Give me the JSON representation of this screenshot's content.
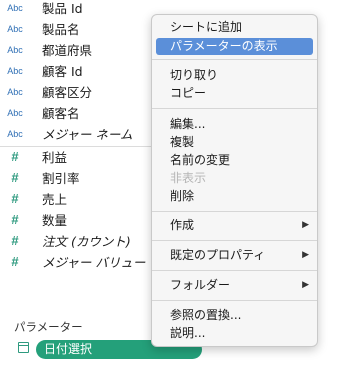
{
  "fields": [
    {
      "type": "Abc",
      "name": "製品 Id",
      "italic": false
    },
    {
      "type": "Abc",
      "name": "製品名",
      "italic": false
    },
    {
      "type": "Abc",
      "name": "都道府県",
      "italic": false
    },
    {
      "type": "Abc",
      "name": "顧客 Id",
      "italic": false
    },
    {
      "type": "Abc",
      "name": "顧客区分",
      "italic": false
    },
    {
      "type": "Abc",
      "name": "顧客名",
      "italic": false
    },
    {
      "type": "Abc",
      "name": "メジャー ネーム",
      "italic": true
    },
    {
      "type": "#",
      "name": "利益",
      "italic": false
    },
    {
      "type": "#",
      "name": "割引率",
      "italic": false
    },
    {
      "type": "#",
      "name": "売上",
      "italic": false
    },
    {
      "type": "#",
      "name": "数量",
      "italic": false
    },
    {
      "type": "#",
      "name": "注文 (カウント)",
      "italic": true
    },
    {
      "type": "#",
      "name": "メジャー バリュー",
      "italic": true
    }
  ],
  "parameters": {
    "header": "パラメーター",
    "items": [
      {
        "name": "日付選択"
      }
    ]
  },
  "context_menu": {
    "items": [
      {
        "label": "シートに追加",
        "highlighted": false,
        "disabled": false,
        "submenu": false
      },
      {
        "label": "パラメーターの表示",
        "highlighted": true,
        "disabled": false,
        "submenu": false
      },
      {
        "label": "切り取り",
        "highlighted": false,
        "disabled": false,
        "submenu": false
      },
      {
        "label": "コピー",
        "highlighted": false,
        "disabled": false,
        "submenu": false
      },
      {
        "label": "編集...",
        "highlighted": false,
        "disabled": false,
        "submenu": false
      },
      {
        "label": "複製",
        "highlighted": false,
        "disabled": false,
        "submenu": false
      },
      {
        "label": "名前の変更",
        "highlighted": false,
        "disabled": false,
        "submenu": false
      },
      {
        "label": "非表示",
        "highlighted": false,
        "disabled": true,
        "submenu": false
      },
      {
        "label": "削除",
        "highlighted": false,
        "disabled": false,
        "submenu": false
      },
      {
        "label": "作成",
        "highlighted": false,
        "disabled": false,
        "submenu": true
      },
      {
        "label": "既定のプロパティ",
        "highlighted": false,
        "disabled": false,
        "submenu": true
      },
      {
        "label": "フォルダー",
        "highlighted": false,
        "disabled": false,
        "submenu": true
      },
      {
        "label": "参照の置換...",
        "highlighted": false,
        "disabled": false,
        "submenu": false
      },
      {
        "label": "説明...",
        "highlighted": false,
        "disabled": false,
        "submenu": false
      }
    ],
    "submenu_arrow": "▶"
  },
  "colors": {
    "menu_highlight": "#5b8fd9",
    "parameter_pill": "#24a07a",
    "dimension_icon": "#2f6fb5",
    "measure_icon": "#2e9a7f"
  }
}
